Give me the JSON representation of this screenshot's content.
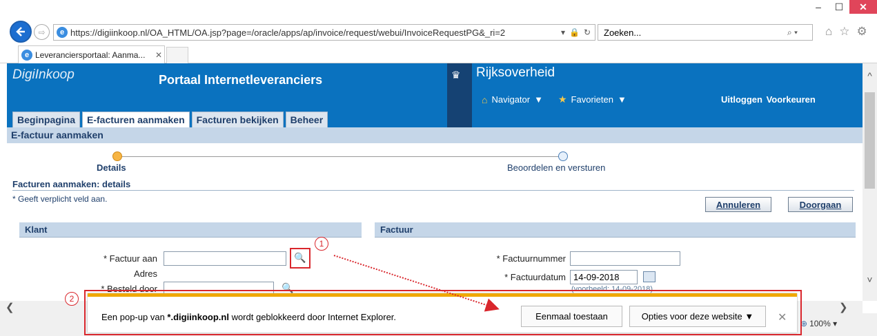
{
  "browser": {
    "url": "https://digiinkoop.nl/OA_HTML/OA.jsp?page=/oracle/apps/ap/invoice/request/webui/InvoiceRequestPG&_ri=2",
    "search_placeholder": "Zoeken...",
    "tab_title": "Leveranciersportaal: Aanma..."
  },
  "header": {
    "brand": "DigiInkoop",
    "portal_title": "Portaal Internetleveranciers",
    "org": "Rijksoverheid",
    "navigator": "Navigator",
    "favorieten": "Favorieten",
    "logout": "Uitloggen",
    "prefs": "Voorkeuren"
  },
  "tabs": [
    "Beginpagina",
    "E-facturen aanmaken",
    "Facturen bekijken",
    "Beheer"
  ],
  "subtitle": "E-factuur aanmaken",
  "train": {
    "step1": "Details",
    "step2": "Beoordelen en versturen"
  },
  "page": {
    "heading": "Facturen aanmaken: details",
    "required_note": "* Geeft verplicht veld aan.",
    "cancel": "Annuleren",
    "continue": "Doorgaan"
  },
  "klant": {
    "title": "Klant",
    "factuur_aan": "* Factuur aan",
    "adres": "Adres",
    "besteld_door": "* Besteld door"
  },
  "factuur": {
    "title": "Factuur",
    "nummer_label": "* Factuurnummer",
    "datum_label": "* Factuurdatum",
    "datum_value": "14-09-2018",
    "example": "(voorbeeld: 14-09-2018)"
  },
  "annotations": {
    "badge1": "1",
    "badge2": "2"
  },
  "popup": {
    "msg_pre": "Een pop-up van ",
    "msg_domain": "*.digiinkoop.nl",
    "msg_post": " wordt geblokkeerd door Internet Explorer.",
    "allow": "Eenmaal toestaan",
    "options": "Opties voor deze website"
  },
  "zoom": "100%",
  "colors": {
    "banner": "#0a72bf",
    "logo_bar": "#154273",
    "highlight": "#d9262c",
    "popup_accent": "#f0a800"
  }
}
